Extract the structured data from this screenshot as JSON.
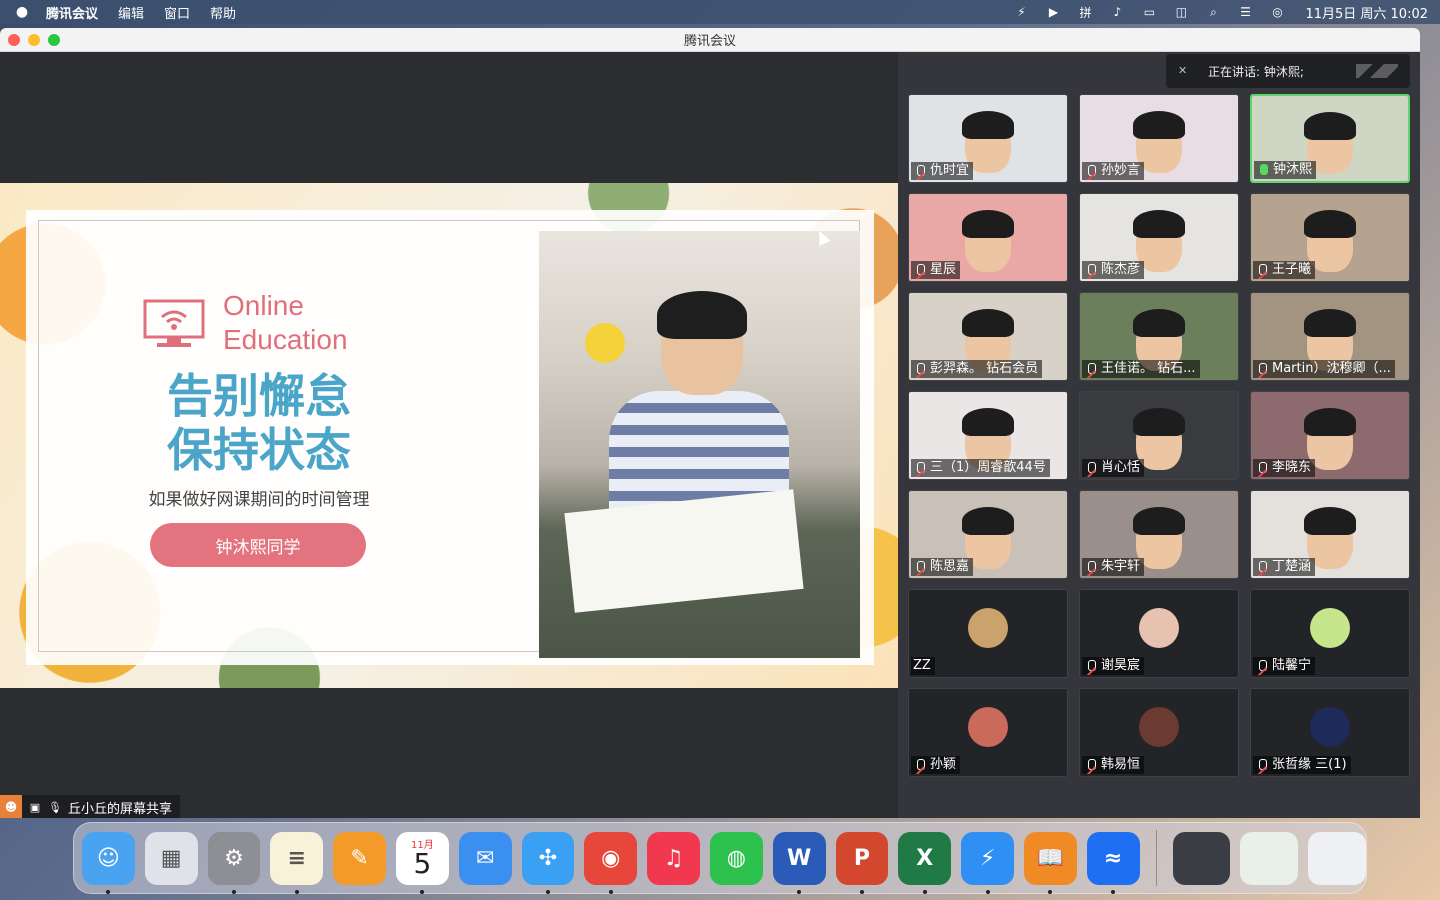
{
  "menubar": {
    "apple": "",
    "items": [
      "腾讯会议",
      "编辑",
      "窗口",
      "帮助"
    ],
    "clock": "11月5日 周六  10:02",
    "status_icons": [
      "bolt-icon",
      "play-circle-icon",
      "input-method-icon",
      "volume-icon",
      "battery-icon",
      "screen-mirror-icon",
      "search-icon",
      "control-center-icon",
      "siri-icon"
    ]
  },
  "window": {
    "title": "腾讯会议"
  },
  "speaking": {
    "text": "正在讲话: 钟沐熙;"
  },
  "slide": {
    "brand_line1": "Online",
    "brand_line2": "Education",
    "headline_line1": "告别懈怠",
    "headline_line2": "保持状态",
    "subline": "如果做好网课期间的时间管理",
    "pill": "钟沐熙同学"
  },
  "participants": [
    {
      "name": "仇时宜",
      "mic": "muted",
      "bg": "#dfe3e6"
    },
    {
      "name": "孙妙言",
      "mic": "muted",
      "bg": "#e8dde3"
    },
    {
      "name": "钟沐熙",
      "mic": "on",
      "bg": "#cfd6c4",
      "active": true
    },
    {
      "name": "星辰",
      "mic": "muted",
      "bg": "#e9a7a5"
    },
    {
      "name": "陈杰彦",
      "mic": "muted",
      "bg": "#e6e4e1"
    },
    {
      "name": "王子曦",
      "mic": "muted",
      "bg": "#b5a28f"
    },
    {
      "name": "彭羿森。    钻石会员",
      "mic": "muted",
      "bg": "#d8d1c8"
    },
    {
      "name": "王佳诺。    钻石...",
      "mic": "muted",
      "bg": "#6b7f5c"
    },
    {
      "name": "Martin）沈穆卿（...",
      "mic": "muted",
      "bg": "#a39481"
    },
    {
      "name": "三（1）周睿歆44号",
      "mic": "muted",
      "bg": "#ebe6e6"
    },
    {
      "name": "肖心恬",
      "mic": "muted",
      "bg": "#3a3b3f"
    },
    {
      "name": "李晓东",
      "mic": "muted",
      "bg": "#8c6a6d"
    },
    {
      "name": "陈思嘉",
      "mic": "muted",
      "bg": "#c9c1b7"
    },
    {
      "name": "朱宇轩",
      "mic": "muted",
      "bg": "#9a8f8a"
    },
    {
      "name": "丁楚涵",
      "mic": "muted",
      "bg": "#e4e1dd"
    },
    {
      "name": "ZZ",
      "mic": "none",
      "bg": "#232428",
      "avatar": "#c9a36b"
    },
    {
      "name": "谢昊宸",
      "mic": "muted",
      "bg": "#232428",
      "avatar": "#e8c2b1"
    },
    {
      "name": "陆馨宁",
      "mic": "muted",
      "bg": "#232428",
      "avatar": "#c7e58a"
    },
    {
      "name": "孙颖",
      "mic": "muted",
      "bg": "#232428",
      "avatar": "#c96a5a"
    },
    {
      "name": "韩易恒",
      "mic": "muted",
      "bg": "#232428",
      "avatar": "#6b3a30"
    },
    {
      "name": "张哲缘 三(1)",
      "mic": "muted",
      "bg": "#232428",
      "avatar": "#1e2a5a"
    }
  ],
  "sharebar": {
    "label": "丘小丘的屏幕共享"
  },
  "dock": {
    "apps": [
      {
        "name": "finder-icon",
        "color": "#4aa3f0",
        "glyph": "☺"
      },
      {
        "name": "launchpad-icon",
        "color": "#dfe2e8",
        "glyph": "▦"
      },
      {
        "name": "system-settings-icon",
        "color": "#8d8f94",
        "glyph": "⚙"
      },
      {
        "name": "notes-icon",
        "color": "#f7f2d8",
        "glyph": "≡"
      },
      {
        "name": "pages-icon",
        "color": "#f39a2b",
        "glyph": "✎"
      },
      {
        "name": "calendar-icon",
        "color": "#ffffff",
        "glyph": ""
      },
      {
        "name": "mail-icon",
        "color": "#3b8ff0",
        "glyph": "✉"
      },
      {
        "name": "safari-icon",
        "color": "#3aa0f4",
        "glyph": "✣"
      },
      {
        "name": "chrome-icon",
        "color": "#e7463a",
        "glyph": "◉"
      },
      {
        "name": "music-icon",
        "color": "#f2384f",
        "glyph": "♫"
      },
      {
        "name": "wechat-icon",
        "color": "#2dc14e",
        "glyph": "◍"
      },
      {
        "name": "word-icon",
        "color": "#2b5bb8",
        "glyph": "W"
      },
      {
        "name": "powerpoint-icon",
        "color": "#d2472e",
        "glyph": "P"
      },
      {
        "name": "excel-icon",
        "color": "#1f7a45",
        "glyph": "X"
      },
      {
        "name": "spark-icon",
        "color": "#2f8ff2",
        "glyph": "⚡"
      },
      {
        "name": "books-icon",
        "color": "#f08a24",
        "glyph": "📖"
      },
      {
        "name": "tencent-meeting-icon",
        "color": "#1f6ff2",
        "glyph": "≈"
      }
    ],
    "running_dots": [
      0,
      2,
      3,
      5,
      7,
      8,
      11,
      12,
      13,
      14,
      15,
      16
    ],
    "calendar": {
      "month": "11月",
      "day": "5"
    },
    "recent": [
      {
        "name": "screenshot-thumb-icon",
        "color": "#3a3d44"
      },
      {
        "name": "spreadsheet-thumb-icon",
        "color": "#e9efe9"
      },
      {
        "name": "trash-icon",
        "color": "#eef0f3"
      }
    ]
  }
}
